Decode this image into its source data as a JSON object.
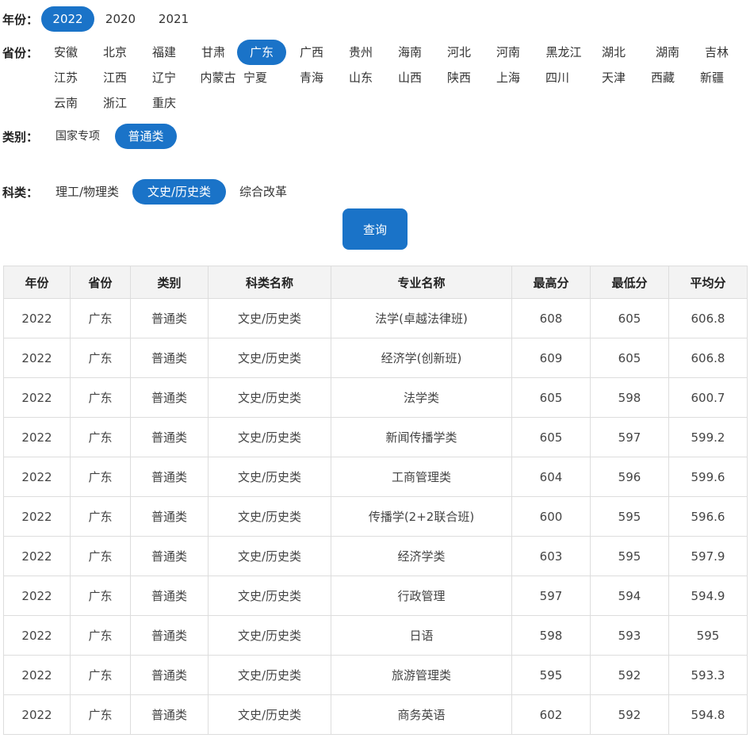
{
  "filters": {
    "year": {
      "label": "年份：",
      "options": [
        "2022",
        "2020",
        "2021"
      ],
      "selected": "2022"
    },
    "province": {
      "label": "省份：",
      "options": [
        "安徽",
        "北京",
        "福建",
        "甘肃",
        "广东",
        "广西",
        "贵州",
        "海南",
        "河北",
        "河南",
        "黑龙江",
        "湖北",
        "湖南",
        "吉林",
        "江苏",
        "江西",
        "辽宁",
        "内蒙古",
        "宁夏",
        "青海",
        "山东",
        "山西",
        "陕西",
        "上海",
        "四川",
        "天津",
        "西藏",
        "新疆",
        "云南",
        "浙江",
        "重庆"
      ],
      "selected": "广东"
    },
    "category": {
      "label": "类别：",
      "options": [
        "国家专项",
        "普通类"
      ],
      "selected": "普通类"
    },
    "subject": {
      "label": "科类：",
      "options": [
        "理工/物理类",
        "文史/历史类",
        "综合改革"
      ],
      "selected": "文史/历史类"
    }
  },
  "query_button": {
    "label": "查询"
  },
  "table": {
    "headers": [
      "年份",
      "省份",
      "类别",
      "科类名称",
      "专业名称",
      "最高分",
      "最低分",
      "平均分"
    ],
    "rows": [
      [
        "2022",
        "广东",
        "普通类",
        "文史/历史类",
        "法学(卓越法律班)",
        "608",
        "605",
        "606.8"
      ],
      [
        "2022",
        "广东",
        "普通类",
        "文史/历史类",
        "经济学(创新班)",
        "609",
        "605",
        "606.8"
      ],
      [
        "2022",
        "广东",
        "普通类",
        "文史/历史类",
        "法学类",
        "605",
        "598",
        "600.7"
      ],
      [
        "2022",
        "广东",
        "普通类",
        "文史/历史类",
        "新闻传播学类",
        "605",
        "597",
        "599.2"
      ],
      [
        "2022",
        "广东",
        "普通类",
        "文史/历史类",
        "工商管理类",
        "604",
        "596",
        "599.6"
      ],
      [
        "2022",
        "广东",
        "普通类",
        "文史/历史类",
        "传播学(2+2联合班)",
        "600",
        "595",
        "596.6"
      ],
      [
        "2022",
        "广东",
        "普通类",
        "文史/历史类",
        "经济学类",
        "603",
        "595",
        "597.9"
      ],
      [
        "2022",
        "广东",
        "普通类",
        "文史/历史类",
        "行政管理",
        "597",
        "594",
        "594.9"
      ],
      [
        "2022",
        "广东",
        "普通类",
        "文史/历史类",
        "日语",
        "598",
        "593",
        "595"
      ],
      [
        "2022",
        "广东",
        "普通类",
        "文史/历史类",
        "旅游管理类",
        "595",
        "592",
        "593.3"
      ],
      [
        "2022",
        "广东",
        "普通类",
        "文史/历史类",
        "商务英语",
        "602",
        "592",
        "594.8"
      ]
    ]
  },
  "colors": {
    "accent": "#1a73c8",
    "header_bg": "#f3f3f3",
    "border": "#dddddd"
  }
}
